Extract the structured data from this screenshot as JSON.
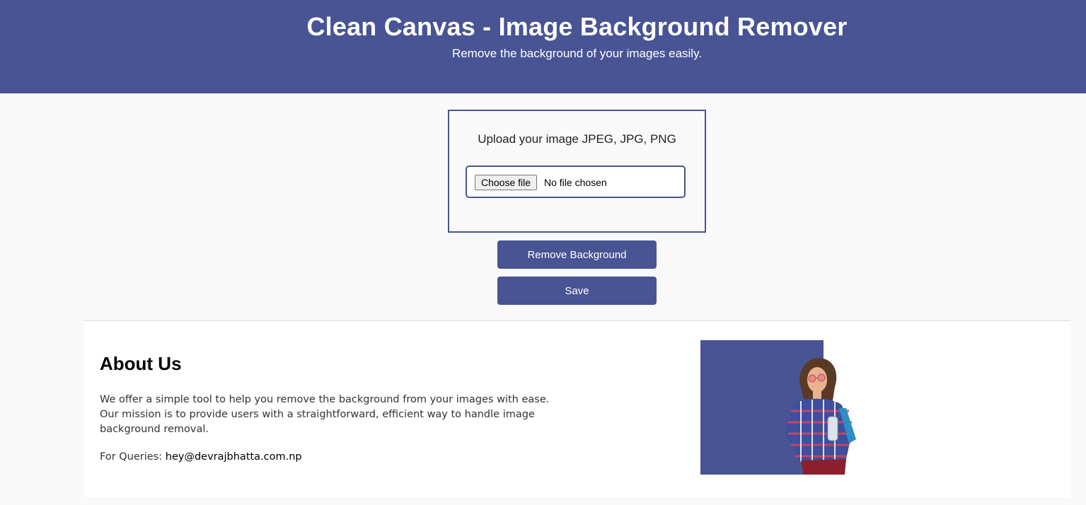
{
  "header": {
    "title": "Clean Canvas - Image Background Remover",
    "subtitle": "Remove the background of your images easily."
  },
  "upload": {
    "title": "Upload your image JPEG, JPG, PNG",
    "choose_file_label": "Choose file",
    "file_status": "No file chosen"
  },
  "actions": {
    "remove_label": "Remove Background",
    "save_label": "Save"
  },
  "about": {
    "heading": "About Us",
    "description": "We offer a simple tool to help you remove the background from your images with ease. Our mission is to provide users with a straightforward, efficient way to handle image background removal.",
    "queries_label": "For Queries:",
    "email": "hey@devrajbhatta.com.np"
  },
  "colors": {
    "brand": "#485494",
    "page_bg": "#f9f9f9",
    "panel_bg": "#ffffff"
  }
}
